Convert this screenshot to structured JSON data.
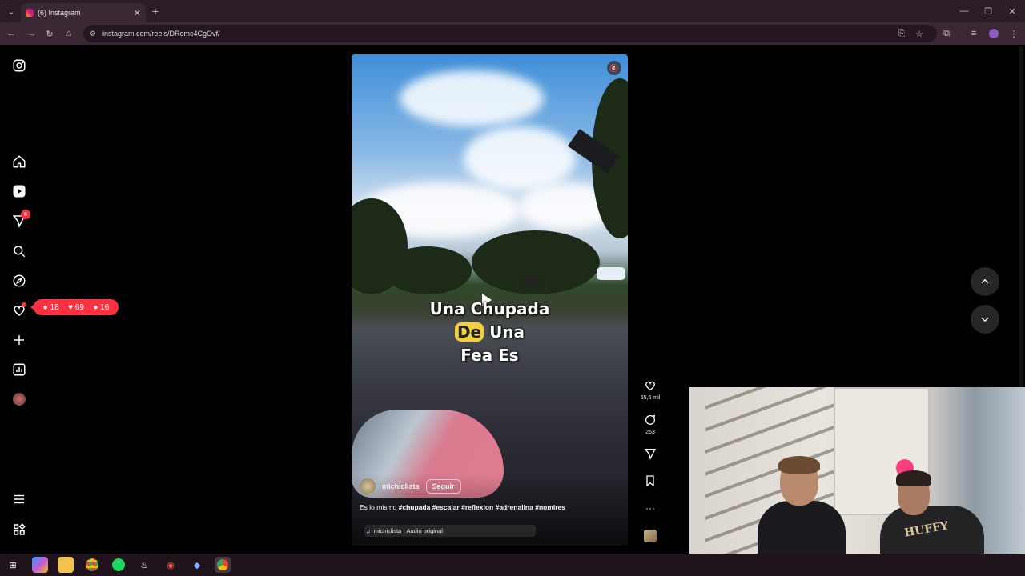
{
  "browser": {
    "tab_title": "(6) Instagram",
    "tab_close": "✕",
    "new_tab": "+",
    "url": "instagram.com/reels/DRomc4CgOvf/",
    "window_min": "—",
    "window_max": "❐",
    "window_close": "✕"
  },
  "sidebar": {
    "notification_badge": "6",
    "activity": {
      "comments": "18",
      "likes": "69",
      "followers": "16"
    }
  },
  "reel": {
    "overlay_line1_a": "Una C",
    "overlay_line1_b": "hupada",
    "overlay_highlight": "De",
    "overlay_line2_rest": " Una",
    "overlay_line3": "Fea Es",
    "author": "michiclista",
    "follow_label": "Seguir",
    "description_plain": "Es lo mismo ",
    "hashtags": "#chupada #escalar #reflexion #adrenalina #nomires",
    "audio": "michiclista · Audio original"
  },
  "actions": {
    "likes": "65,6 mil",
    "comments": "263",
    "more": "···"
  },
  "webcam": {
    "hoodie_text": "HUFFY"
  }
}
